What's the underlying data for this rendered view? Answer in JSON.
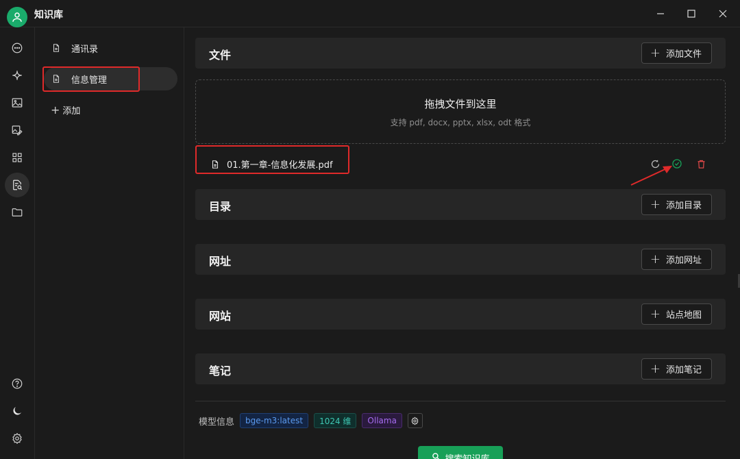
{
  "app": {
    "title": "知识库"
  },
  "sidebar": {
    "items": [
      {
        "label": "通讯录",
        "icon": "document-icon"
      },
      {
        "label": "信息管理",
        "icon": "document-icon",
        "active": true
      }
    ],
    "add_label": "添加"
  },
  "sections": [
    {
      "title": "文件",
      "button": "添加文件"
    },
    {
      "title": "目录",
      "button": "添加目录"
    },
    {
      "title": "网址",
      "button": "添加网址"
    },
    {
      "title": "网站",
      "button": "站点地图"
    },
    {
      "title": "笔记",
      "button": "添加笔记"
    }
  ],
  "dropzone": {
    "title": "拖拽文件到这里",
    "subtitle": "支持 pdf, docx, pptx, xlsx, odt 格式"
  },
  "files": [
    {
      "name": "01.第一章-信息化发展.pdf",
      "status": "done"
    }
  ],
  "model_info": {
    "label": "模型信息",
    "tags": [
      {
        "text": "bge-m3:latest",
        "color": "#5b9bf0"
      },
      {
        "text": "1024 维",
        "color": "#3ec7b3"
      },
      {
        "text": "Ollama",
        "color": "#a66cf0"
      }
    ]
  },
  "search_button": "搜索知识库",
  "colors": {
    "accent": "#18a058",
    "annotation_red": "#e02a2a",
    "success": "#18a058",
    "danger": "#e04848"
  }
}
